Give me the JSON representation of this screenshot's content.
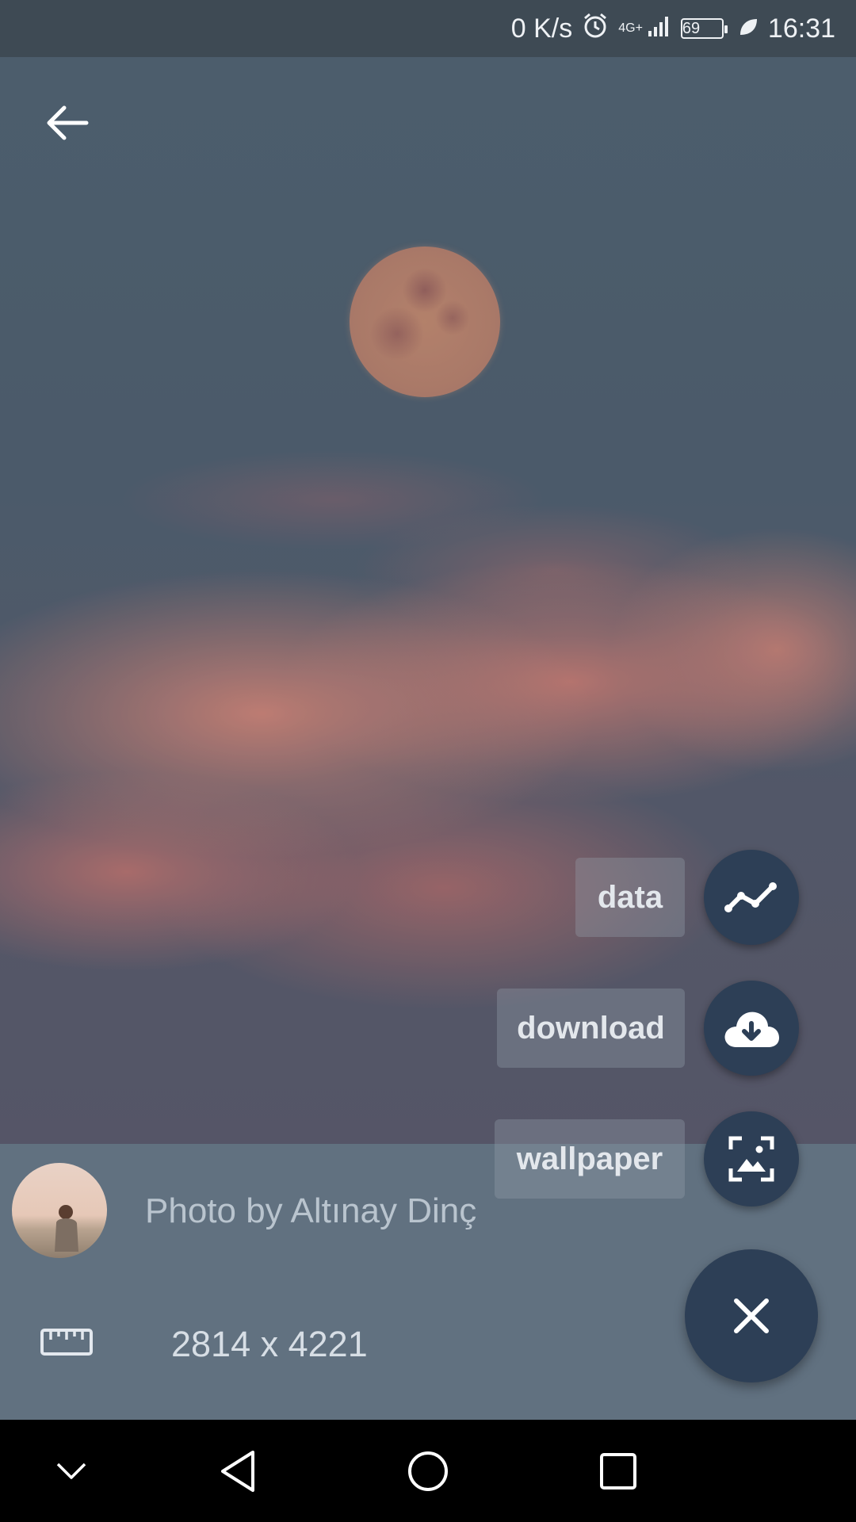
{
  "status_bar": {
    "net_speed": "0 K/s",
    "network": "4G+",
    "battery_level": "69",
    "time": "16:31"
  },
  "photo": {
    "credit": "Photo by Altınay Dinç",
    "dimensions": "2814 x 4221"
  },
  "actions": {
    "data_label": "data",
    "download_label": "download",
    "wallpaper_label": "wallpaper"
  },
  "colors": {
    "fab_background": "#2d3f56",
    "info_panel": "#617180"
  },
  "icons": [
    "back-arrow-icon",
    "chart-line-icon",
    "cloud-download-icon",
    "wallpaper-icon",
    "close-icon",
    "ruler-icon",
    "alarm-icon",
    "signal-icon",
    "battery-icon",
    "leaf-icon",
    "nav-down-icon",
    "nav-back-icon",
    "nav-home-icon",
    "nav-recents-icon"
  ]
}
